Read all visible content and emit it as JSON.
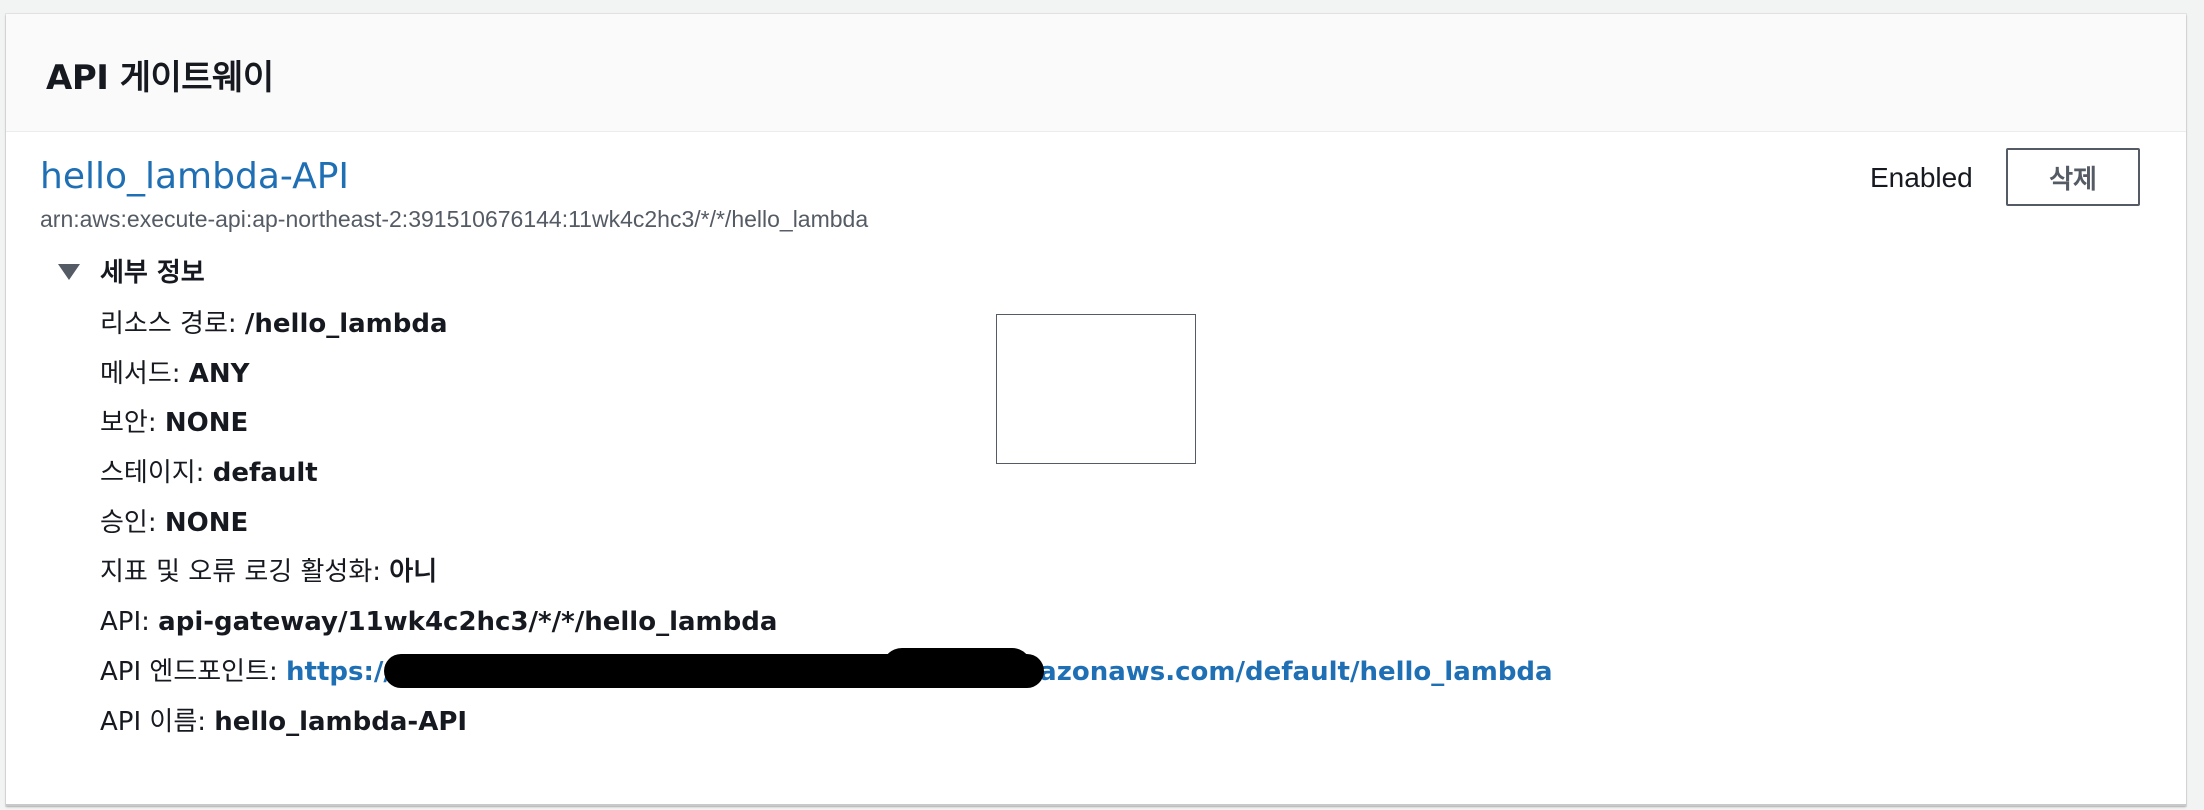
{
  "panel": {
    "title": "API 게이트웨이"
  },
  "api": {
    "name": "hello_lambda-API",
    "arn": "arn:aws:execute-api:ap-northeast-2:391510676144:11wk4c2hc3/*/*/hello_lambda",
    "status": "Enabled",
    "delete_label": "삭제"
  },
  "details": {
    "toggle_label": "세부 정보",
    "rows": [
      {
        "key": "리소스 경로: ",
        "value": "/hello_lambda"
      },
      {
        "key": "메서드: ",
        "value": "ANY"
      },
      {
        "key": "보안: ",
        "value": "NONE"
      },
      {
        "key": "스테이지: ",
        "value": "default"
      },
      {
        "key": "승인: ",
        "value": "NONE"
      },
      {
        "key": "지표 및 오류 로깅 활성화: ",
        "value": "아니"
      },
      {
        "key": "API: ",
        "value": "api-gateway/11wk4c2hc3/*/*/hello_lambda"
      },
      {
        "key": "API 엔드포인트: ",
        "value": "https://11wk4c2hc3.execute-api.ap-northeast-2.amazonaws.com/default/hello_lambda"
      },
      {
        "key": "API 이름: ",
        "value": "hello_lambda-API"
      }
    ]
  },
  "colors": {
    "link": "#1f6fb5",
    "text": "#16191f",
    "muted": "#545b64"
  },
  "icons": {
    "toggle": "caret-down-icon"
  }
}
